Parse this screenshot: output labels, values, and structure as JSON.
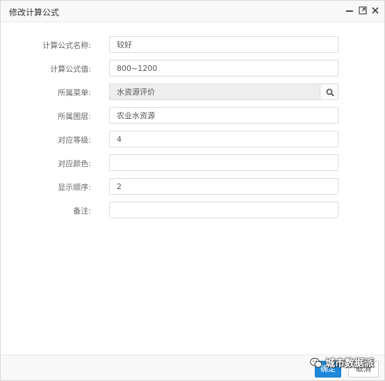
{
  "dialog": {
    "title": "修改计算公式"
  },
  "form": {
    "fields": [
      {
        "label": "计算公式名称:",
        "value": ""
      },
      {
        "label": "计算公式值:",
        "value": ""
      },
      {
        "label": "所属菜单:",
        "value": ""
      },
      {
        "label": "所属图层:",
        "value": ""
      },
      {
        "label": "对应等级:",
        "value": ""
      },
      {
        "label": "对应颜色:",
        "value": ""
      },
      {
        "label": "显示顺序:",
        "value": ""
      },
      {
        "label": "备注:",
        "value": ""
      }
    ],
    "values": {
      "name": "较好",
      "formula": "800~1200",
      "menu": "水资源评价",
      "layer": "农业水资源",
      "level": "4",
      "color": "",
      "order": "2",
      "remark": ""
    }
  },
  "footer": {
    "ok_label": "确定",
    "cancel_label": "取消"
  },
  "watermark": {
    "text": "城市数据派"
  },
  "icons": {
    "minimize": "minimize-icon",
    "maximize": "maximize-icon",
    "close": "close-icon",
    "search": "search-icon"
  }
}
